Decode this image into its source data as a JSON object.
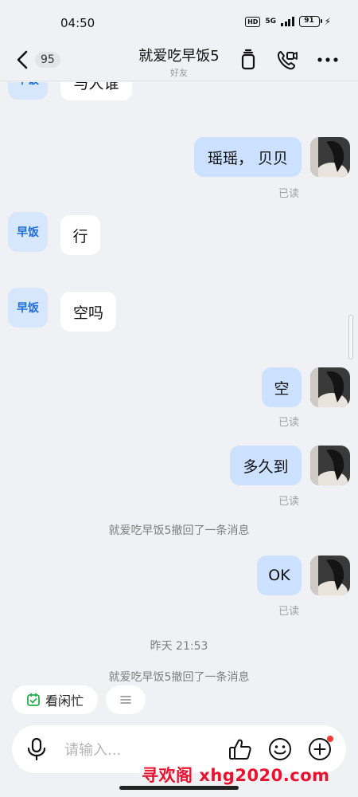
{
  "status_bar": {
    "time": "04:50",
    "hd": "HD",
    "network": "5G",
    "battery": "91",
    "icons": [
      "hd-icon",
      "5g-signal-icon",
      "battery-icon",
      "charging-icon"
    ]
  },
  "header": {
    "back_count": "95",
    "title": "就爱吃早饭5",
    "subtitle": "好友",
    "icons": [
      "back-arrow-icon",
      "delete-icon",
      "video-call-icon",
      "more-icon"
    ]
  },
  "contact": {
    "avatar_text": "早饭"
  },
  "messages": [
    {
      "side": "in",
      "text": "与人谁",
      "partial": true
    },
    {
      "side": "out",
      "text": "瑶瑶， 贝贝",
      "read": "已读"
    },
    {
      "side": "in",
      "text": "行"
    },
    {
      "side": "in",
      "text": "空吗"
    },
    {
      "side": "out",
      "text": "空",
      "read": "已读"
    },
    {
      "side": "out",
      "text": "多久到",
      "read": "已读"
    },
    {
      "side": "system",
      "text": "就爱吃早饭5撤回了一条消息"
    },
    {
      "side": "out",
      "text": "OK",
      "read": "已读"
    },
    {
      "side": "timestamp",
      "text": "昨天 21:53"
    },
    {
      "side": "system",
      "text": "就爱吃早饭5撤回了一条消息"
    }
  ],
  "chips": {
    "status_label": "看闲忙",
    "menu_icon": "menu-icon"
  },
  "input": {
    "placeholder": "请输入...",
    "icons": [
      "microphone-icon",
      "thumbs-up-icon",
      "emoji-icon",
      "plus-icon"
    ]
  },
  "watermark": "寻欢阁 xhg2020.com",
  "colors": {
    "background": "#f0f1f4",
    "outgoing_bubble": "#cce0ff",
    "incoming_bubble": "#ffffff",
    "contact_avatar_bg": "#d6e6fb",
    "contact_avatar_text": "#1d6fe0",
    "status_chip_icon": "#21b04b",
    "notification_dot": "#f43a3a",
    "watermark": "#e8132f"
  }
}
